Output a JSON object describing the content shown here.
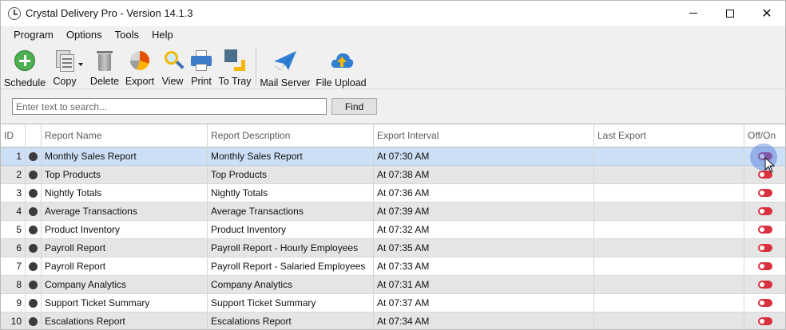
{
  "window": {
    "title": "Crystal Delivery Pro - Version 14.1.3",
    "controls": {
      "minimize": "minimize",
      "maximize": "maximize",
      "close": "✕"
    }
  },
  "menu": [
    "Program",
    "Options",
    "Tools",
    "Help"
  ],
  "toolbar": {
    "schedule": {
      "label": "Schedule",
      "icon": "plus-circle-icon"
    },
    "copy": {
      "label": "Copy",
      "icon": "copy-document-icon"
    },
    "delete": {
      "label": "Delete",
      "icon": "trash-icon"
    },
    "export": {
      "label": "Export",
      "icon": "pie-chart-icon"
    },
    "view": {
      "label": "View",
      "icon": "magnifier-icon"
    },
    "print": {
      "label": "Print",
      "icon": "printer-icon"
    },
    "totray": {
      "label": "To Tray",
      "icon": "to-tray-icon"
    },
    "mailserver": {
      "label": "Mail Server",
      "icon": "paper-plane-icon"
    },
    "fileupload": {
      "label": "File Upload",
      "icon": "cloud-upload-icon"
    }
  },
  "search": {
    "placeholder": "Enter text to search...",
    "value": "",
    "button": "Find"
  },
  "grid": {
    "headers": [
      "ID",
      "",
      "Report Name",
      "Report Description",
      "Export Interval",
      "Last Export",
      "Off/On"
    ],
    "selected_row": 1,
    "rows": [
      {
        "id": "1",
        "name": "Monthly Sales Report",
        "description": "Monthly Sales Report",
        "interval": "At 07:30 AM",
        "last_export": "",
        "enabled": false
      },
      {
        "id": "2",
        "name": "Top Products",
        "description": "Top Products",
        "interval": "At 07:38 AM",
        "last_export": "",
        "enabled": false
      },
      {
        "id": "3",
        "name": "Nightly Totals",
        "description": "Nightly Totals",
        "interval": "At 07:36 AM",
        "last_export": "",
        "enabled": false
      },
      {
        "id": "4",
        "name": "Average Transactions",
        "description": "Average Transactions",
        "interval": "At 07:39 AM",
        "last_export": "",
        "enabled": false
      },
      {
        "id": "5",
        "name": "Product Inventory",
        "description": "Product Inventory",
        "interval": "At 07:32 AM",
        "last_export": "",
        "enabled": false
      },
      {
        "id": "6",
        "name": "Payroll Report",
        "description": "Payroll Report - Hourly Employees",
        "interval": "At 07:35 AM",
        "last_export": "",
        "enabled": false
      },
      {
        "id": "7",
        "name": "Payroll Report",
        "description": "Payroll Report - Salaried Employees",
        "interval": "At 07:33 AM",
        "last_export": "",
        "enabled": false
      },
      {
        "id": "8",
        "name": "Company Analytics",
        "description": "Company Analytics",
        "interval": "At 07:31 AM",
        "last_export": "",
        "enabled": false
      },
      {
        "id": "9",
        "name": "Support Ticket Summary",
        "description": "Support Ticket Summary",
        "interval": "At 07:37 AM",
        "last_export": "",
        "enabled": false
      },
      {
        "id": "10",
        "name": "Escalations Report",
        "description": "Escalations Report",
        "interval": "At 07:34 AM",
        "last_export": "",
        "enabled": false
      }
    ]
  },
  "colors": {
    "toggle_off": "#d9303e",
    "selected_row": "#cddff4",
    "alt_row": "#e5e5e5",
    "status_dot": "#3c3c3c"
  }
}
